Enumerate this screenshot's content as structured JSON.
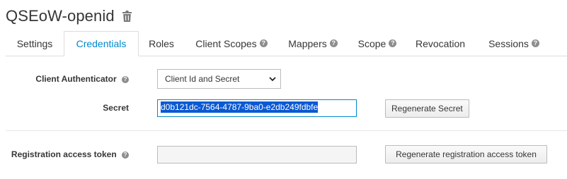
{
  "header": {
    "title": "QSEoW-openid",
    "delete_icon": "trash-icon"
  },
  "tabs": [
    {
      "label": "Settings",
      "active": false,
      "help": false
    },
    {
      "label": "Credentials",
      "active": true,
      "help": false
    },
    {
      "label": "Roles",
      "active": false,
      "help": false
    },
    {
      "label": "Client Scopes",
      "active": false,
      "help": true
    },
    {
      "label": "Mappers",
      "active": false,
      "help": true
    },
    {
      "label": "Scope",
      "active": false,
      "help": true
    },
    {
      "label": "Revocation",
      "active": false,
      "help": false
    },
    {
      "label": "Sessions",
      "active": false,
      "help": true
    }
  ],
  "form": {
    "client_authenticator": {
      "label": "Client Authenticator",
      "selected": "Client Id and Secret"
    },
    "secret": {
      "label": "Secret",
      "value": "d0b121dc-7564-4787-9ba0-e2db249fdbfe",
      "button": "Regenerate Secret"
    },
    "registration_token": {
      "label": "Registration access token",
      "value": "",
      "button": "Regenerate registration access token"
    }
  },
  "colors": {
    "accent": "#0088ce",
    "selection": "#0b59d2",
    "help_icon": "#8b8d8f"
  }
}
